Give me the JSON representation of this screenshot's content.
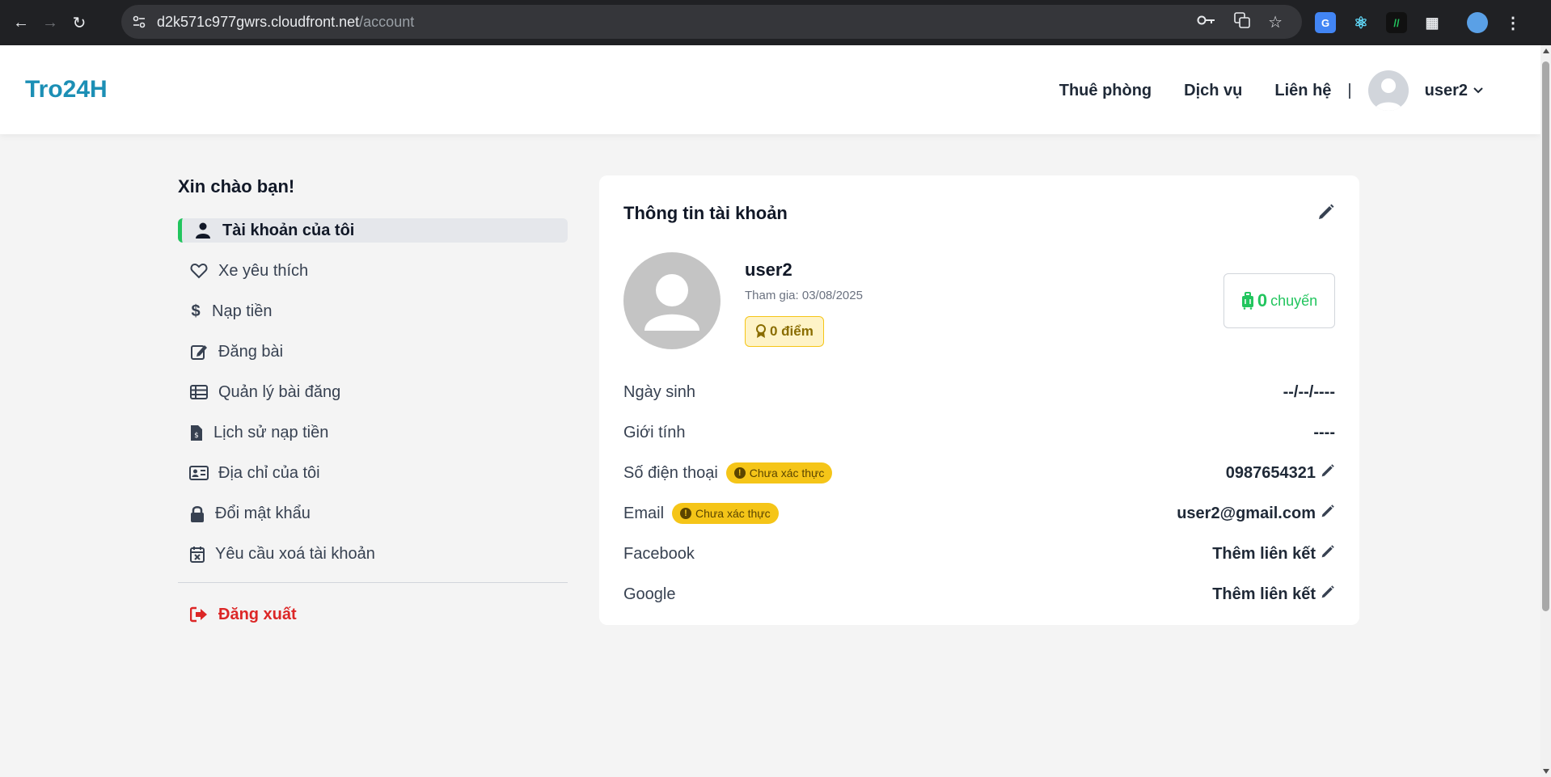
{
  "browser": {
    "url_host": "d2k571c977gwrs.cloudfront.net",
    "url_path": "/account"
  },
  "header": {
    "logo": "Tro24H",
    "nav": [
      "Thuê phòng",
      "Dịch vụ",
      "Liên hệ"
    ],
    "separator": "|",
    "username": "user2"
  },
  "sidebar": {
    "greeting": "Xin chào bạn!",
    "items": [
      {
        "label": "Tài khoản của tôi",
        "icon": "user-icon",
        "active": true
      },
      {
        "label": "Xe yêu thích",
        "icon": "heart-icon"
      },
      {
        "label": "Nạp tiền",
        "icon": "dollar-icon"
      },
      {
        "label": "Đăng bài",
        "icon": "edit-icon"
      },
      {
        "label": "Quản lý bài đăng",
        "icon": "table-icon"
      },
      {
        "label": "Lịch sử nạp tiền",
        "icon": "invoice-icon"
      },
      {
        "label": "Địa chỉ của tôi",
        "icon": "address-card-icon"
      },
      {
        "label": "Đổi mật khẩu",
        "icon": "lock-icon"
      },
      {
        "label": "Yêu cầu xoá tài khoản",
        "icon": "calendar-x-icon"
      }
    ],
    "logout": "Đăng xuất"
  },
  "account": {
    "title": "Thông tin tài khoản",
    "name": "user2",
    "joined": "Tham gia: 03/08/2025",
    "points": "0 điểm",
    "trips_count": "0",
    "trips_label": "chuyến",
    "rows": [
      {
        "label": "Ngày sinh",
        "value": "--/--/----"
      },
      {
        "label": "Giới tính",
        "value": "----"
      },
      {
        "label": "Số điện thoại",
        "badge": "Chưa xác thực",
        "value": "0987654321"
      },
      {
        "label": "Email",
        "badge": "Chưa xác thực",
        "value": "user2@gmail.com"
      },
      {
        "label": "Facebook",
        "value": "Thêm liên kết"
      },
      {
        "label": "Google",
        "value": "Thêm liên kết"
      }
    ]
  },
  "colors": {
    "brand": "#1c8fb5",
    "active_accent": "#22c55e",
    "logout": "#dc2626",
    "badge": "#f5c518"
  }
}
